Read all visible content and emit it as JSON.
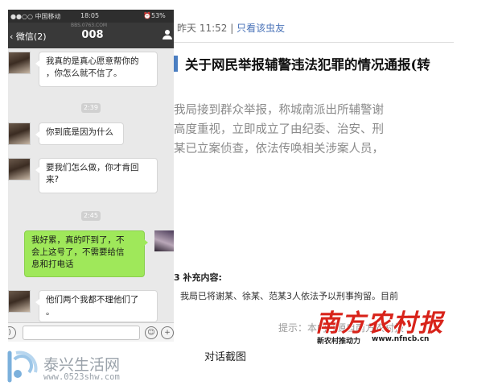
{
  "phone": {
    "status": {
      "carrier": "●●○○ 中国移动",
      "time": "18:05",
      "battery": "53%"
    },
    "nav": {
      "back_label": "微信(2)",
      "title": "008",
      "watermark": "BBS.0763.COM"
    },
    "messages": [
      {
        "side": "left",
        "text_lines": [
          "我真的是真心愿意帮你的",
          "，你怎么就不信了。"
        ]
      },
      {
        "time": "2:39"
      },
      {
        "side": "left",
        "text_lines": [
          "你到底是因为什么"
        ]
      },
      {
        "side": "left",
        "text_lines": [
          "要我们怎么做，你才肯回",
          "来?"
        ]
      },
      {
        "time": "2:45"
      },
      {
        "side": "right",
        "text_lines": [
          "我好累，真的吓到了，不",
          "会上这号了，不需要给信",
          "息和打电话"
        ]
      },
      {
        "side": "left",
        "text_lines": [
          "他们两个我都不理他们了",
          "。"
        ]
      }
    ]
  },
  "news": {
    "meta_time": "昨天 11:52",
    "meta_sep": "|",
    "meta_only": "只看该虫友",
    "title": "关于网民举报辅警违法犯罪的情况通报(转",
    "body_lines": [
      "我局接到群众举报，称城南派出所辅警谢",
      "高度重视，立即成立了由纪委、治安、刑",
      "某已立案侦查，依法传唤相关涉案人员，"
    ],
    "supplement_title": "3 补充内容:",
    "supplement_body": "我局已将谢某、徐某、范某3人依法予以刑事拘留。目前",
    "hint": "提示：本内容源自南方农村报"
  },
  "logo": {
    "main": "南方农村报",
    "slogan": "新农村推动力",
    "url": "www.nfncb.cn"
  },
  "caption": "对话截图",
  "site": {
    "name": "泰兴生活网",
    "url": "www.0523shw.com"
  },
  "colors": {
    "bubble_me": "#9fe85a",
    "nav_bar": "#393939",
    "logo_red": "#d8231a",
    "link_blue": "#4a73b8"
  }
}
